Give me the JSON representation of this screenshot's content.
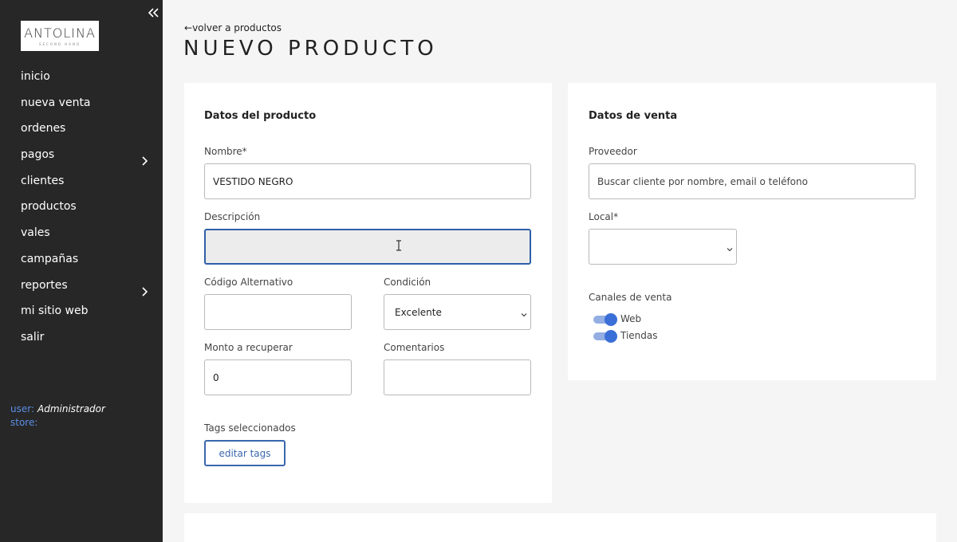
{
  "brand": {
    "name": "ANTOLINA",
    "tagline": "SECOND HAND"
  },
  "sidebar": {
    "items": [
      {
        "label": "inicio",
        "has_submenu": false
      },
      {
        "label": "nueva venta",
        "has_submenu": false
      },
      {
        "label": "ordenes",
        "has_submenu": false
      },
      {
        "label": "pagos",
        "has_submenu": true
      },
      {
        "label": "clientes",
        "has_submenu": false
      },
      {
        "label": "productos",
        "has_submenu": false
      },
      {
        "label": "vales",
        "has_submenu": false
      },
      {
        "label": "campañas",
        "has_submenu": false
      },
      {
        "label": "reportes",
        "has_submenu": true
      },
      {
        "label": "mi sitio web",
        "has_submenu": false
      },
      {
        "label": "salir",
        "has_submenu": false
      }
    ],
    "user_key": "user:",
    "user_value": "Administrador",
    "store_key": "store:",
    "store_value": ""
  },
  "header": {
    "back_link": "volver a productos",
    "title": "NUEVO PRODUCTO"
  },
  "product": {
    "section_title": "Datos del producto",
    "name_label": "Nombre*",
    "name_value": "VESTIDO NEGRO",
    "description_label": "Descripción",
    "description_value": "",
    "alt_code_label": "Código Alternativo",
    "alt_code_value": "",
    "condition_label": "Condición",
    "condition_value": "Excelente",
    "amount_label": "Monto a recuperar",
    "amount_value": "0",
    "comments_label": "Comentarios",
    "comments_value": "",
    "tags_label": "Tags seleccionados",
    "tags_button": "editar tags"
  },
  "sale": {
    "section_title": "Datos de venta",
    "provider_label": "Proveedor",
    "provider_placeholder": "Buscar cliente por nombre, email o teléfono",
    "local_label": "Local*",
    "local_value": "",
    "channels_label": "Canales de venta",
    "channels": [
      {
        "label": "Web",
        "enabled": true
      },
      {
        "label": "Tiendas",
        "enabled": true
      }
    ]
  },
  "colors": {
    "sidebar_bg": "#272727",
    "accent": "#3b6fd8",
    "page_bg": "#f5f5f5"
  },
  "icons": {
    "collapse": "double-chevron-left-icon",
    "submenu": "chevron-right-icon",
    "back": "arrow-left-icon",
    "select": "chevron-down-icon"
  }
}
